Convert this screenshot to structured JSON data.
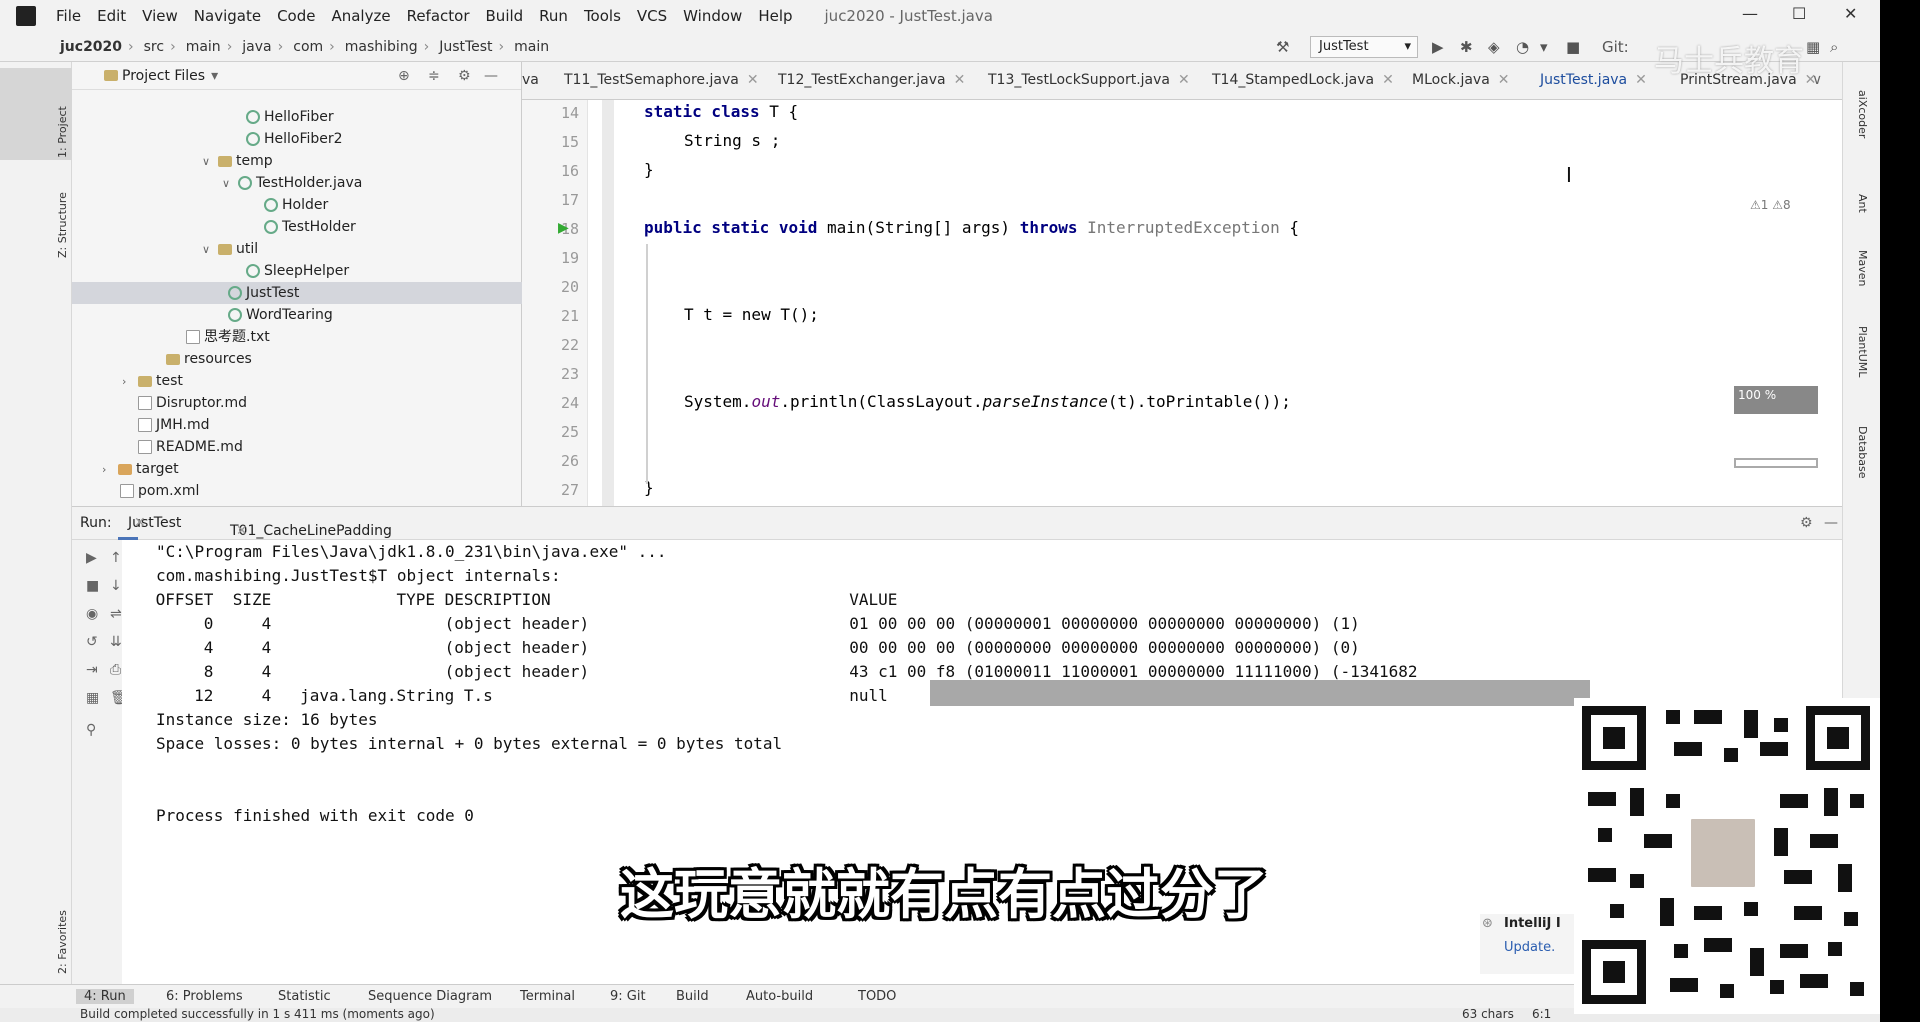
{
  "menubar": {
    "items": [
      "File",
      "Edit",
      "View",
      "Navigate",
      "Code",
      "Analyze",
      "Refactor",
      "Build",
      "Run",
      "Tools",
      "VCS",
      "Window",
      "Help"
    ],
    "window_title": "juc2020 - JustTest.java"
  },
  "breadcrumb": [
    "juc2020",
    "src",
    "main",
    "java",
    "com",
    "mashibing",
    "JustTest",
    "main"
  ],
  "toolbar": {
    "run_config": "JustTest",
    "git_label": "Git:"
  },
  "left_strip": {
    "tabs": [
      "1: Project",
      "Z: Structure",
      "2: Favorites"
    ]
  },
  "right_strip": {
    "tabs": [
      "aiXcoder",
      "Ant",
      "Maven",
      "PlantUML",
      "Database"
    ]
  },
  "project": {
    "header": "Project Files",
    "tree": [
      {
        "label": "HelloFiber",
        "kind": "class"
      },
      {
        "label": "HelloFiber2",
        "kind": "class"
      },
      {
        "label": "temp",
        "kind": "folder"
      },
      {
        "label": "TestHolder.java",
        "kind": "class"
      },
      {
        "label": "Holder",
        "kind": "class"
      },
      {
        "label": "TestHolder",
        "kind": "class"
      },
      {
        "label": "util",
        "kind": "folder"
      },
      {
        "label": "SleepHelper",
        "kind": "class"
      },
      {
        "label": "JustTest",
        "kind": "class"
      },
      {
        "label": "WordTearing",
        "kind": "class"
      },
      {
        "label": "思考题.txt",
        "kind": "file"
      },
      {
        "label": "resources",
        "kind": "folder"
      },
      {
        "label": "test",
        "kind": "folder"
      },
      {
        "label": "Disruptor.md",
        "kind": "file"
      },
      {
        "label": "JMH.md",
        "kind": "file"
      },
      {
        "label": "README.md",
        "kind": "file"
      },
      {
        "label": "target",
        "kind": "folder"
      },
      {
        "label": "pom.xml",
        "kind": "file"
      }
    ]
  },
  "editor_tabs": [
    "va",
    "T11_TestSemaphore.java",
    "T12_TestExchanger.java",
    "T13_TestLockSupport.java",
    "T14_StampedLock.java",
    "MLock.java",
    "JustTest.java",
    "PrintStream.java"
  ],
  "editor": {
    "inspection": "⚠1 ⚠8",
    "line_numbers": [
      "14",
      "15",
      "16",
      "17",
      "18",
      "19",
      "20",
      "21",
      "22",
      "23",
      "24",
      "25",
      "26",
      "27"
    ],
    "code": {
      "l14_kw": "static class",
      "l14_rest": " T {",
      "l15": "String s ;",
      "l16": "}",
      "l18_kw": "public static void",
      "l18_rest": " main(String[] args) ",
      "l18_throws": "throws",
      "l18_ex": " InterruptedException ",
      "l18_end": "{",
      "l21": "T t = new T();",
      "l24_a": "System.",
      "l24_out": "out",
      "l24_b": ".println(ClassLayout.",
      "l24_parse": "parseInstance",
      "l24_c": "(t).toPrintable());",
      "l27": "}"
    },
    "zoom": "100 %"
  },
  "run": {
    "label": "Run:",
    "tabs": [
      "JustTest",
      "T01_CacheLinePadding"
    ],
    "console": [
      "\"C:\\Program Files\\Java\\jdk1.8.0_231\\bin\\java.exe\" ...",
      "com.mashibing.JustTest$T object internals:",
      " OFFSET  SIZE             TYPE DESCRIPTION                               VALUE",
      "      0     4                  (object header)                           01 00 00 00 (00000001 00000000 00000000 00000000) (1)",
      "      4     4                  (object header)                           00 00 00 00 (00000000 00000000 00000000 00000000) (0)",
      "      8     4                  (object header)                           43 c1 00 f8 (01000011 11000001 00000000 11111000) (-1341682",
      "     12     4   java.lang.String T.s                                     null",
      "Instance size: 16 bytes",
      "Space losses: 0 bytes internal + 0 bytes external = 0 bytes total",
      "Process finished with exit code 0"
    ]
  },
  "bottom_tools": [
    "4: Run",
    "6: Problems",
    "Statistic",
    "Sequence Diagram",
    "Terminal",
    "9: Git",
    "Build",
    "Auto-build",
    "TODO"
  ],
  "status": {
    "message": "Build completed successfully in 1 s 411 ms (moments ago)",
    "chars": "63 chars",
    "position": "6:1"
  },
  "notification": {
    "title": "IntelliJ I",
    "link": "Update."
  },
  "subtitle": "这玩意就就有点有点过分了",
  "watermark": "马士兵教育"
}
